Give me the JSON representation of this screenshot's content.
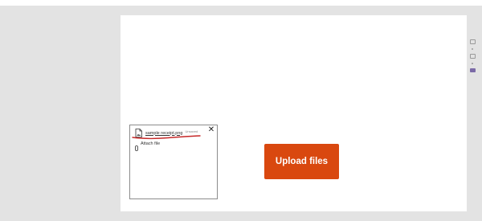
{
  "attachment": {
    "file_name": "sample receipt.png",
    "file_status": "Unsaved",
    "close_glyph": "✕",
    "attach_label": "Attach file"
  },
  "upload": {
    "label": "Upload files",
    "color": "#d9480f"
  },
  "icons": {
    "file": "file-image-icon",
    "close": "close-icon",
    "paperclip": "paperclip-icon"
  },
  "colors": {
    "background": "#e3e3e3",
    "canvas": "#ffffff",
    "annotation": "#c62828"
  }
}
